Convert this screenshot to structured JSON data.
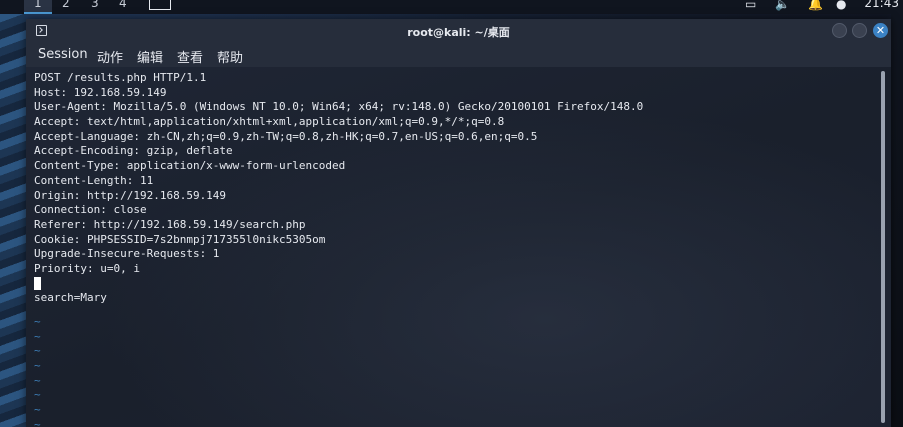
{
  "top_panel": {
    "workspaces": [
      "1",
      "2",
      "3",
      "4"
    ],
    "clock": "21:43"
  },
  "window": {
    "title": "root@kali: ~/桌面",
    "close_symbol": "✕"
  },
  "menubar": {
    "items": [
      "Session",
      "动作",
      "编辑",
      "查看",
      "帮助"
    ]
  },
  "terminal": {
    "lines": [
      "POST /results.php HTTP/1.1",
      "Host: 192.168.59.149",
      "User-Agent: Mozilla/5.0 (Windows NT 10.0; Win64; x64; rv:148.0) Gecko/20100101 Firefox/148.0",
      "Accept: text/html,application/xhtml+xml,application/xml;q=0.9,*/*;q=0.8",
      "Accept-Language: zh-CN,zh;q=0.9,zh-TW;q=0.8,zh-HK;q=0.7,en-US;q=0.6,en;q=0.5",
      "Accept-Encoding: gzip, deflate",
      "Content-Type: application/x-www-form-urlencoded",
      "Content-Length: 11",
      "Origin: http://192.168.59.149",
      "Connection: close",
      "Referer: http://192.168.59.149/search.php",
      "Cookie: PHPSESSID=7s2bnmpj717355l0nikc5305om",
      "Upgrade-Insecure-Requests: 1",
      "Priority: u=0, i",
      "",
      "search=Mary"
    ],
    "tilde": "~",
    "tilde_count": 8
  }
}
